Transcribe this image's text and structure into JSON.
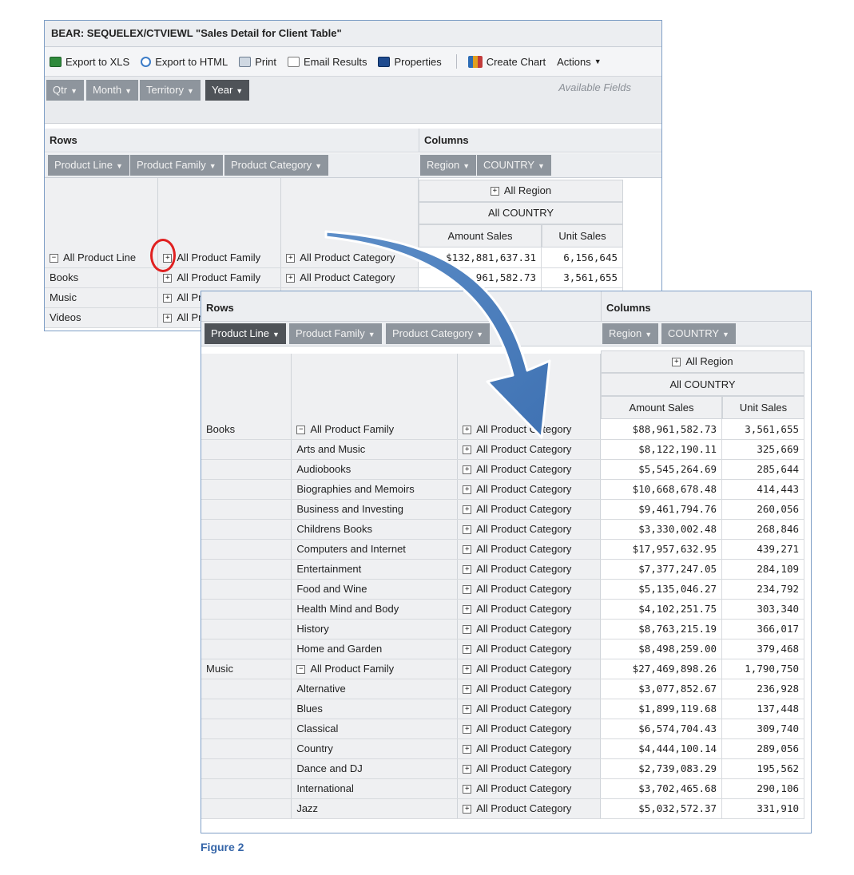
{
  "app": {
    "title": "BEAR: SEQUELEX/CTVIEWL  \"Sales Detail for Client Table\"",
    "toolbar": {
      "export_xls": "Export to XLS",
      "export_html": "Export to HTML",
      "print": "Print",
      "email": "Email Results",
      "properties": "Properties",
      "create_chart": "Create Chart",
      "actions": "Actions"
    },
    "available_chips": [
      "Qtr",
      "Month",
      "Territory",
      "Year"
    ],
    "available_label": "Available Fields"
  },
  "layout_labels": {
    "rows": "Rows",
    "columns": "Columns",
    "row_chips": [
      "Product Line",
      "Product Family",
      "Product Category"
    ],
    "col_chips": [
      "Region",
      "COUNTRY"
    ]
  },
  "column_headers": {
    "region": "All Region",
    "country": "All COUNTRY",
    "amount": "Amount Sales",
    "units": "Unit Sales"
  },
  "back_rows": [
    {
      "line": "All Product Line",
      "family": "All Product Family",
      "category": "All Product Category",
      "amount": "$132,881,637.31",
      "units": "6,156,645"
    },
    {
      "line": "Books",
      "family": "All Product Family",
      "category": "All Product Category",
      "amount": "$88,961,582.73",
      "units": "3,561,655"
    },
    {
      "line": "Music",
      "family": "All Pr",
      "category": "",
      "amount": "",
      "units": ""
    },
    {
      "line": "Videos",
      "family": "All Pr",
      "category": "",
      "amount": "",
      "units": ""
    }
  ],
  "front_rows": [
    {
      "line": "Books",
      "family": "All Product Family",
      "category": "All Product Category",
      "amount": "$88,961,582.73",
      "units": "3,561,655"
    },
    {
      "line": "",
      "family": "Arts and Music",
      "category": "All Product Category",
      "amount": "$8,122,190.11",
      "units": "325,669"
    },
    {
      "line": "",
      "family": "Audiobooks",
      "category": "All Product Category",
      "amount": "$5,545,264.69",
      "units": "285,644"
    },
    {
      "line": "",
      "family": "Biographies and Memoirs",
      "category": "All Product Category",
      "amount": "$10,668,678.48",
      "units": "414,443"
    },
    {
      "line": "",
      "family": "Business and Investing",
      "category": "All Product Category",
      "amount": "$9,461,794.76",
      "units": "260,056"
    },
    {
      "line": "",
      "family": "Childrens Books",
      "category": "All Product Category",
      "amount": "$3,330,002.48",
      "units": "268,846"
    },
    {
      "line": "",
      "family": "Computers and Internet",
      "category": "All Product Category",
      "amount": "$17,957,632.95",
      "units": "439,271"
    },
    {
      "line": "",
      "family": "Entertainment",
      "category": "All Product Category",
      "amount": "$7,377,247.05",
      "units": "284,109"
    },
    {
      "line": "",
      "family": "Food and Wine",
      "category": "All Product Category",
      "amount": "$5,135,046.27",
      "units": "234,792"
    },
    {
      "line": "",
      "family": "Health Mind and Body",
      "category": "All Product Category",
      "amount": "$4,102,251.75",
      "units": "303,340"
    },
    {
      "line": "",
      "family": "History",
      "category": "All Product Category",
      "amount": "$8,763,215.19",
      "units": "366,017"
    },
    {
      "line": "",
      "family": "Home and Garden",
      "category": "All Product Category",
      "amount": "$8,498,259.00",
      "units": "379,468"
    },
    {
      "line": "Music",
      "family": "All Product Family",
      "category": "All Product Category",
      "amount": "$27,469,898.26",
      "units": "1,790,750"
    },
    {
      "line": "",
      "family": "Alternative",
      "category": "All Product Category",
      "amount": "$3,077,852.67",
      "units": "236,928"
    },
    {
      "line": "",
      "family": "Blues",
      "category": "All Product Category",
      "amount": "$1,899,119.68",
      "units": "137,448"
    },
    {
      "line": "",
      "family": "Classical",
      "category": "All Product Category",
      "amount": "$6,574,704.43",
      "units": "309,740"
    },
    {
      "line": "",
      "family": "Country",
      "category": "All Product Category",
      "amount": "$4,444,100.14",
      "units": "289,056"
    },
    {
      "line": "",
      "family": "Dance and DJ",
      "category": "All Product Category",
      "amount": "$2,739,083.29",
      "units": "195,562"
    },
    {
      "line": "",
      "family": "International",
      "category": "All Product Category",
      "amount": "$3,702,465.68",
      "units": "290,106"
    },
    {
      "line": "",
      "family": "Jazz",
      "category": "All Product Category",
      "amount": "$5,032,572.37",
      "units": "331,910"
    }
  ],
  "figure_caption": "Figure 2",
  "colors": {
    "accent": "#3565a8",
    "frame": "#7f9fc6",
    "chip": "#8e959d",
    "chip_dark": "#4f5358",
    "highlight": "#e02020"
  }
}
